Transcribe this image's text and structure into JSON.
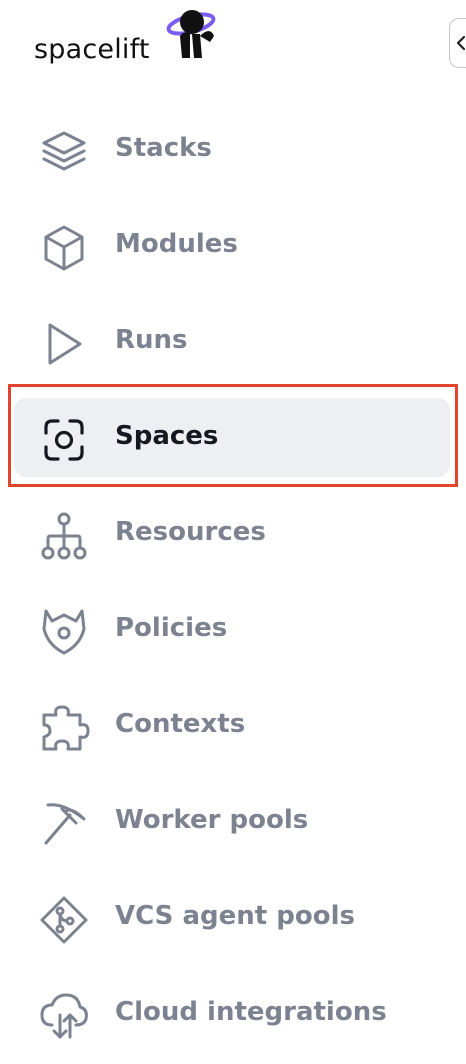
{
  "brand": {
    "name": "spacelift"
  },
  "nav": {
    "items": [
      {
        "label": "Stacks",
        "icon": "layers-icon"
      },
      {
        "label": "Modules",
        "icon": "cube-icon"
      },
      {
        "label": "Runs",
        "icon": "play-icon"
      },
      {
        "label": "Spaces",
        "icon": "spaces-focus-icon",
        "active": true
      },
      {
        "label": "Resources",
        "icon": "resources-tree-icon"
      },
      {
        "label": "Policies",
        "icon": "policies-shield-icon"
      },
      {
        "label": "Contexts",
        "icon": "puzzle-icon"
      },
      {
        "label": "Worker pools",
        "icon": "pickaxe-icon"
      },
      {
        "label": "VCS agent pools",
        "icon": "vcs-git-icon"
      },
      {
        "label": "Cloud integrations",
        "icon": "cloud-sync-icon"
      }
    ]
  },
  "colors": {
    "active_text": "#15181e",
    "inactive_text": "#7c8290",
    "active_bg": "#eeeff3",
    "highlight": "#e0452d"
  }
}
